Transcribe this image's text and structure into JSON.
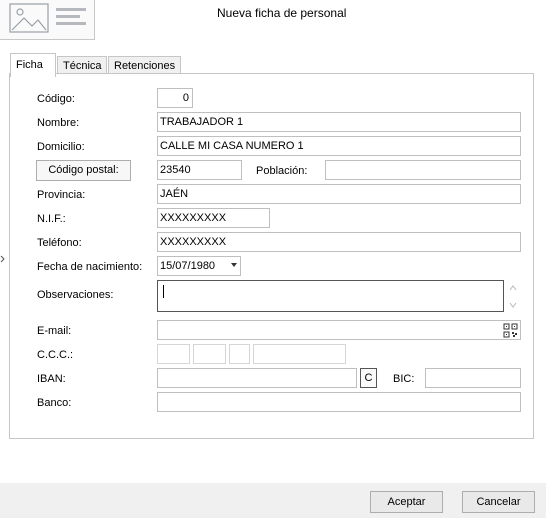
{
  "dialog": {
    "title": "Nueva ficha de personal"
  },
  "tabs": [
    {
      "label": "Ficha",
      "active": true
    },
    {
      "label": "Técnica",
      "active": false
    },
    {
      "label": "Retenciones",
      "active": false
    }
  ],
  "form": {
    "codigo": {
      "label": "Código:",
      "value": "0"
    },
    "nombre": {
      "label": "Nombre:",
      "value": "TRABAJADOR 1"
    },
    "domicilio": {
      "label": "Domicilio:",
      "value": "CALLE MI CASA NUMERO 1"
    },
    "codigo_postal": {
      "button_label": "Código postal:",
      "value": "23540"
    },
    "poblacion": {
      "label": "Población:",
      "value": ""
    },
    "provincia": {
      "label": "Provincia:",
      "value": "JAÉN"
    },
    "nif": {
      "label": "N.I.F.:",
      "value": "XXXXXXXXX"
    },
    "telefono": {
      "label": "Teléfono:",
      "value": "XXXXXXXXX"
    },
    "fecha_nacimiento": {
      "label": "Fecha de nacimiento:",
      "value": "15/07/1980"
    },
    "observaciones": {
      "label": "Observaciones:",
      "value": ""
    },
    "email": {
      "label": "E-mail:",
      "value": ""
    },
    "ccc": {
      "label": "C.C.C.:",
      "values": [
        "",
        "",
        "",
        ""
      ]
    },
    "iban": {
      "label": "IBAN:",
      "value": "",
      "button_label": "C"
    },
    "bic": {
      "label": "BIC:",
      "value": ""
    },
    "banco": {
      "label": "Banco:",
      "value": ""
    }
  },
  "footer": {
    "accept_label": "Aceptar",
    "cancel_label": "Cancelar"
  },
  "icons": [
    "image-placeholder-icon",
    "dropdown-arrow-icon",
    "scroll-up-icon",
    "scroll-down-icon",
    "qr-code-icon",
    "side-arrow-icon"
  ]
}
